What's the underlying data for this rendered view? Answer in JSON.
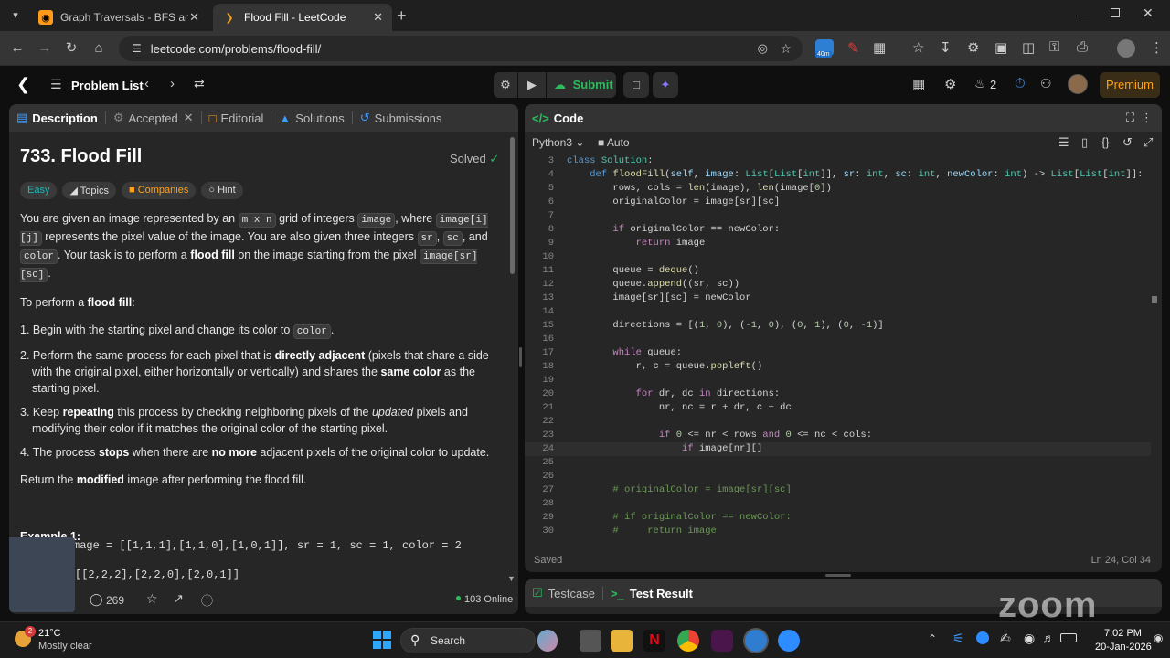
{
  "browser": {
    "tabs": [
      {
        "title": "Graph Traversals - BFS and DFS:",
        "active": false
      },
      {
        "title": "Flood Fill - LeetCode",
        "active": true
      }
    ],
    "url": "leetcode.com/problems/flood-fill/",
    "extension_badge": "40m"
  },
  "header": {
    "problem_list": "Problem List",
    "submit": "Submit",
    "streak_count": "2",
    "premium": "Premium"
  },
  "left_panel": {
    "tabs": [
      "Description",
      "Accepted",
      "Editorial",
      "Solutions",
      "Submissions"
    ],
    "title": "733. Flood Fill",
    "solved": "Solved",
    "chips": [
      "Easy",
      "Topics",
      "Companies",
      "Hint"
    ],
    "para1": {
      "t1": "You are given an image represented by an ",
      "c1": "m x n",
      "t2": " grid of integers ",
      "c2": "image",
      "t3": ", where ",
      "c3": "image[i][j]",
      "t4": " represents the pixel value of the image. You are also given three integers ",
      "c4": "sr",
      "t5": ", ",
      "c5": "sc",
      "t6": ", and ",
      "c6": "color",
      "t7": ". Your task is to perform a ",
      "b1": "flood fill",
      "t8": " on the image starting from the pixel ",
      "c7": "image[sr][sc]",
      "t9": "."
    },
    "para2": {
      "t1": "To perform a ",
      "b1": "flood fill",
      "t2": ":"
    },
    "steps": {
      "s1": {
        "t1": "Begin with the starting pixel and change its color to ",
        "c1": "color",
        "t2": "."
      },
      "s2": {
        "t1": "Perform the same process for each pixel that is ",
        "b1": "directly adjacent",
        "t2": " (pixels that share a side with the original pixel, either horizontally or vertically) and shares the ",
        "b2": "same color",
        "t3": " as the starting pixel."
      },
      "s3": {
        "t1": "Keep ",
        "b1": "repeating",
        "t2": " this process by checking neighboring pixels of the ",
        "i1": "updated",
        "t3": " pixels and modifying their color if it matches the original color of the starting pixel."
      },
      "s4": {
        "t1": "The process ",
        "b1": "stops",
        "t2": " when there are ",
        "b2": "no more",
        "t3": " adjacent pixels of the original color to update."
      }
    },
    "para3": {
      "t1": "Return the ",
      "b1": "modified",
      "t2": " image after performing the flood fill."
    },
    "example_title": "Example 1:",
    "example_input": "mage = [[1,1,1],[1,1,0],[1,0,1]], sr = 1, sc = 1, color = 2",
    "example_output": "[[2,2,2],[2,2,0],[2,0,1]]",
    "comments": "269",
    "online": "103 Online"
  },
  "code_panel": {
    "title": "Code",
    "language": "Python3",
    "mode": "Auto",
    "status": "Saved",
    "cursor": "Ln 24, Col 34",
    "line_numbers": [
      "3",
      "4",
      "5",
      "6",
      "7",
      "8",
      "9",
      "10",
      "11",
      "12",
      "13",
      "14",
      "15",
      "16",
      "17",
      "18",
      "19",
      "20",
      "21",
      "22",
      "23",
      "24",
      "25",
      "26",
      "27",
      "28",
      "29",
      "30"
    ]
  },
  "bottom_panel": {
    "tabs": [
      "Testcase",
      "Test Result"
    ]
  },
  "watermark": "zoom",
  "taskbar": {
    "temp": "21°C",
    "weather": "Mostly clear",
    "weather_badge": "2",
    "search": "Search",
    "time": "7:02 PM",
    "date": "20-Jan-2026"
  }
}
